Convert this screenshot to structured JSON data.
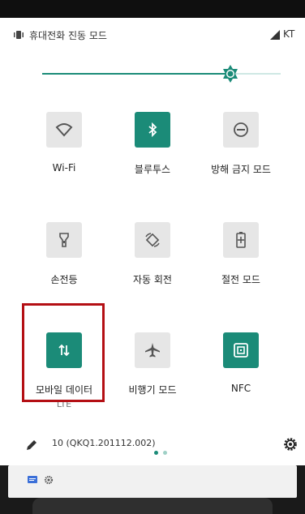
{
  "status": {
    "mode_text": "휴대전화 진동 모드",
    "carrier": "KT"
  },
  "brightness": {
    "level": 0.79
  },
  "tiles": [
    {
      "label": "Wi-Fi",
      "state": "off",
      "icon": "wifi-icon"
    },
    {
      "label": "블루투스",
      "state": "on",
      "icon": "bluetooth-icon"
    },
    {
      "label": "방해 금지 모드",
      "state": "off",
      "icon": "do-not-disturb-icon"
    },
    {
      "label": "손전등",
      "state": "off",
      "icon": "flashlight-icon"
    },
    {
      "label": "자동 회전",
      "state": "off",
      "icon": "auto-rotate-icon"
    },
    {
      "label": "절전 모드",
      "state": "off",
      "icon": "battery-saver-icon"
    },
    {
      "label": "모바일 데이터",
      "sub": "LTE",
      "state": "on",
      "icon": "mobile-data-icon"
    },
    {
      "label": "비행기 모드",
      "state": "off",
      "icon": "airplane-icon"
    },
    {
      "label": "NFC",
      "state": "on",
      "icon": "nfc-icon"
    }
  ],
  "footer": {
    "build": "10 (QKQ1.201112.002)",
    "page_dots": 2,
    "active_dot": 0
  },
  "colors": {
    "accent": "#1b8b78",
    "tile_off": "#e6e6e6",
    "highlight": "#b40f14"
  }
}
